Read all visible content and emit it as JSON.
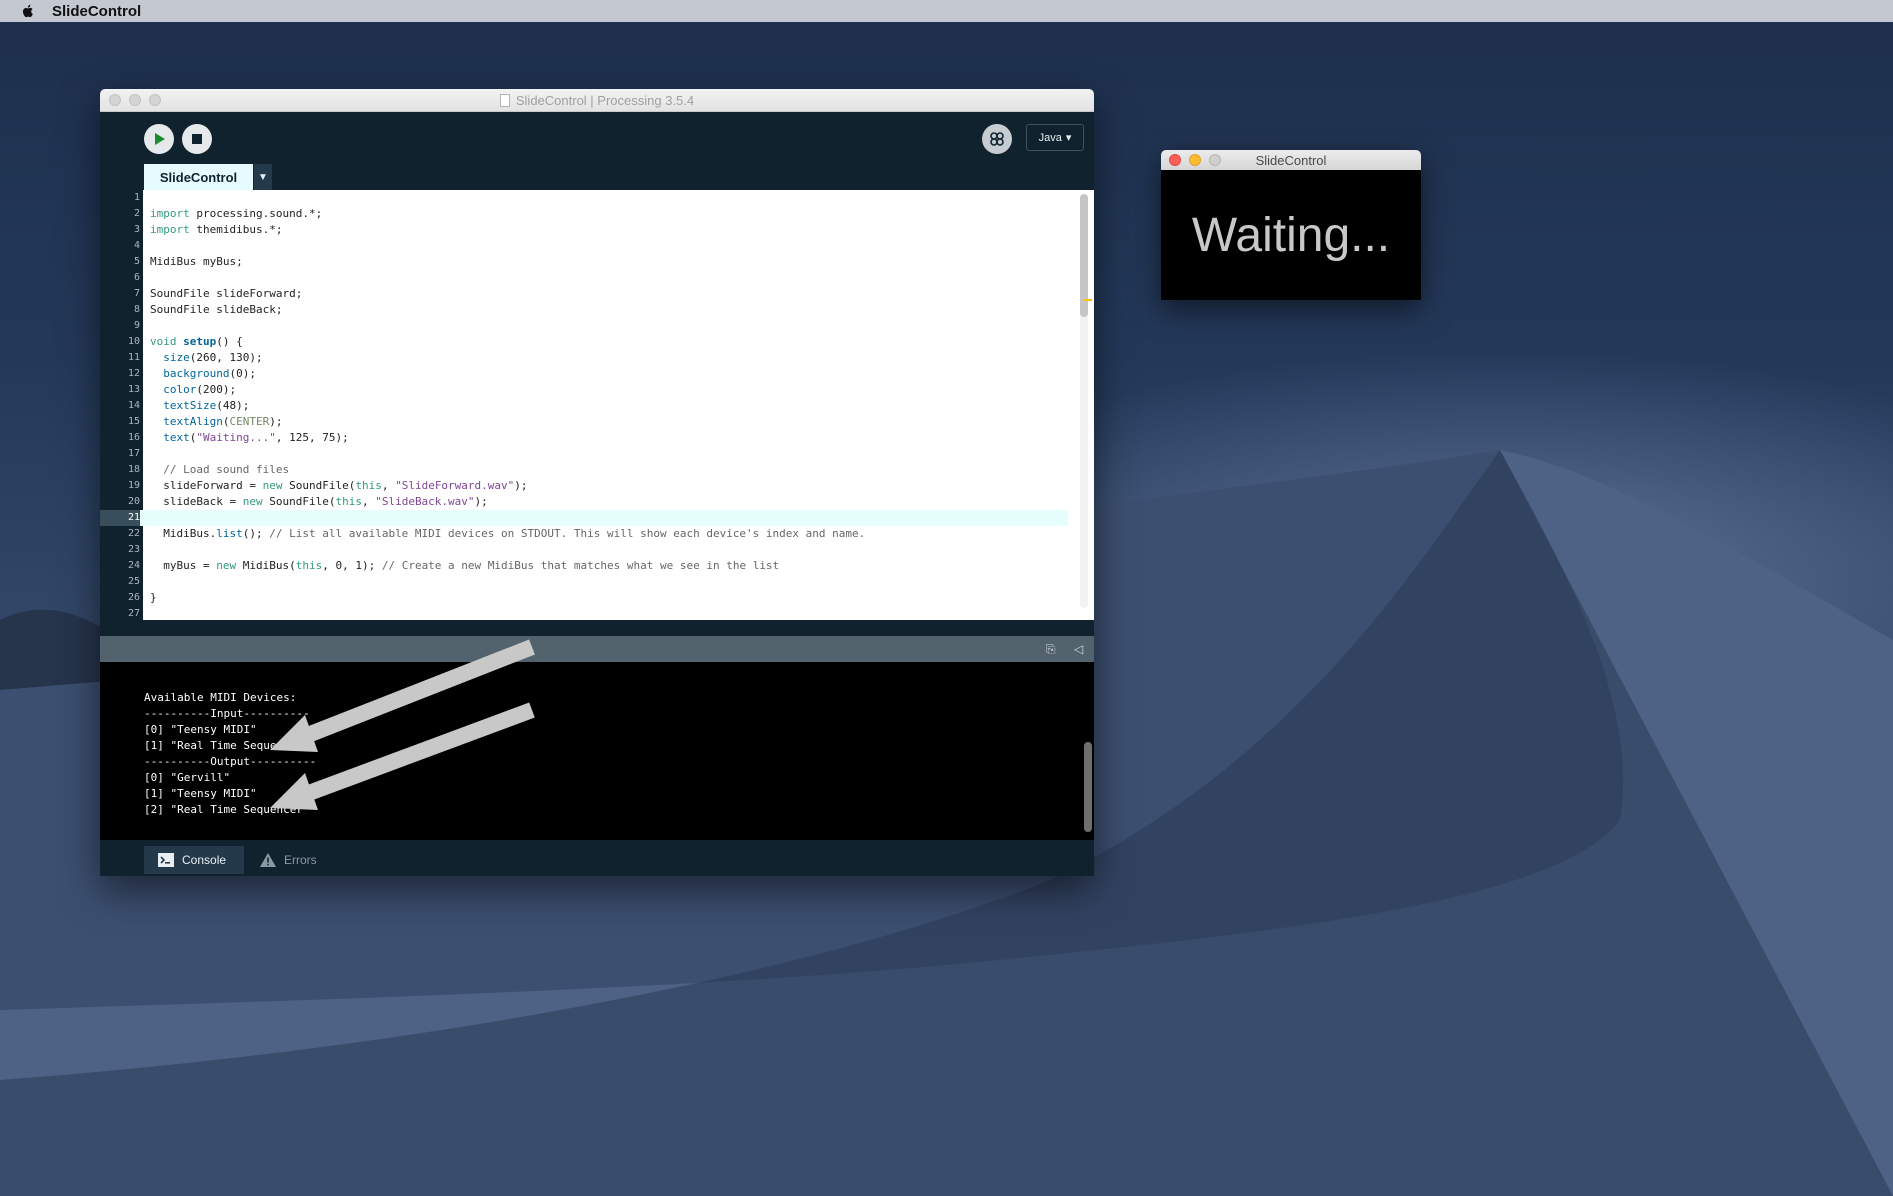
{
  "menubar": {
    "app_name": "SlideControl"
  },
  "processing_window": {
    "title": "SlideControl | Processing 3.5.4",
    "mode_label": "Java",
    "tab_label": "SlideControl",
    "console_tab": "Console",
    "errors_tab": "Errors"
  },
  "code_lines": [
    {
      "n": "1",
      "html": ""
    },
    {
      "n": "2",
      "html": "<span class='kw'>import</span> processing.sound.*;"
    },
    {
      "n": "3",
      "html": "<span class='kw'>import</span> themidibus.*;"
    },
    {
      "n": "4",
      "html": ""
    },
    {
      "n": "5",
      "html": "MidiBus myBus;"
    },
    {
      "n": "6",
      "html": ""
    },
    {
      "n": "7",
      "html": "SoundFile slideForward;"
    },
    {
      "n": "8",
      "html": "SoundFile slideBack;"
    },
    {
      "n": "9",
      "html": ""
    },
    {
      "n": "10",
      "html": "<span class='kw'>void</span> <span class='fb'>setup</span>() {"
    },
    {
      "n": "11",
      "html": "  <span class='fn'>size</span>(260, 130);"
    },
    {
      "n": "12",
      "html": "  <span class='fn'>background</span>(0);"
    },
    {
      "n": "13",
      "html": "  <span class='fn'>color</span>(200);"
    },
    {
      "n": "14",
      "html": "  <span class='fn'>textSize</span>(48);"
    },
    {
      "n": "15",
      "html": "  <span class='fn'>textAlign</span>(<span class='cn'>CENTER</span>);"
    },
    {
      "n": "16",
      "html": "  <span class='fn'>text</span>(<span class='st'>\"Waiting...\"</span>, 125, 75);"
    },
    {
      "n": "17",
      "html": ""
    },
    {
      "n": "18",
      "html": "  <span class='cm'>// Load sound files</span>"
    },
    {
      "n": "19",
      "html": "  slideForward = <span class='kw'>new</span> SoundFile(<span class='kw'>this</span>, <span class='st'>\"SlideForward.wav\"</span>);"
    },
    {
      "n": "20",
      "html": "  slideBack = <span class='kw'>new</span> SoundFile(<span class='kw'>this</span>, <span class='st'>\"SlideBack.wav\"</span>);"
    },
    {
      "n": "21",
      "html": "",
      "current": true
    },
    {
      "n": "22",
      "html": "  MidiBus.<span class='fn'>list</span>(); <span class='cm'>// List all available MIDI devices on STDOUT. This will show each device's index and name.</span>"
    },
    {
      "n": "23",
      "html": ""
    },
    {
      "n": "24",
      "html": "  myBus = <span class='kw'>new</span> MidiBus(<span class='kw'>this</span>, 0, 1); <span class='cm'>// Create a new MidiBus that matches what we see in the list</span>"
    },
    {
      "n": "25",
      "html": ""
    },
    {
      "n": "26",
      "html": "}"
    },
    {
      "n": "27",
      "html": ""
    }
  ],
  "console_lines": [
    "Available MIDI Devices:",
    "----------Input----------",
    "[0] \"Teensy MIDI\"",
    "[1] \"Real Time Sequencer\"",
    "----------Output----------",
    "[0] \"Gervill\"",
    "[1] \"Teensy MIDI\"",
    "[2] \"Real Time Sequencer\""
  ],
  "sketch_window": {
    "title": "SlideControl",
    "canvas_text": "Waiting..."
  }
}
